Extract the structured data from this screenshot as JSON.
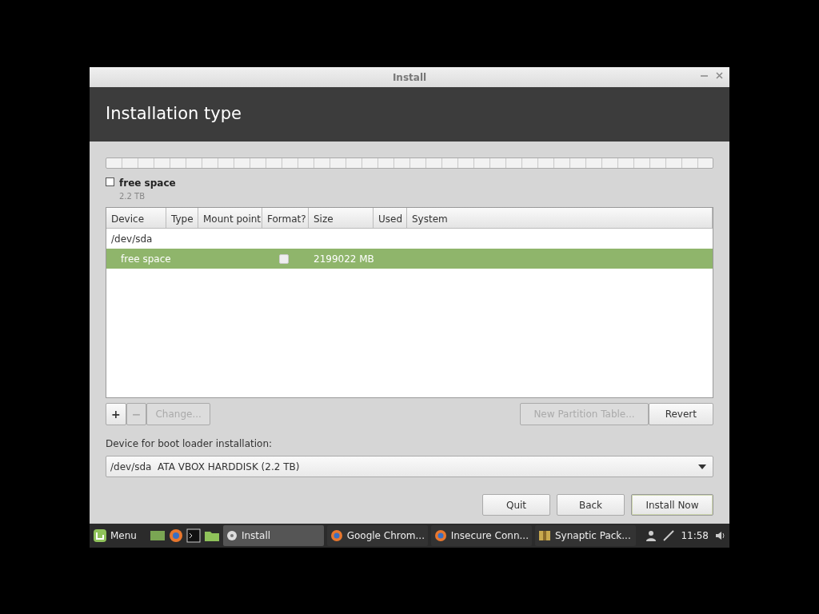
{
  "window": {
    "title": "Install"
  },
  "header": {
    "title": "Installation type"
  },
  "disk_legend": [
    {
      "label": "free space",
      "size": "2.2 TB"
    }
  ],
  "table": {
    "columns": [
      "Device",
      "Type",
      "Mount point",
      "Format?",
      "Size",
      "Used",
      "System"
    ],
    "rows": [
      {
        "device": "/dev/sda",
        "selected": false,
        "children": [
          {
            "device": "free space",
            "format": false,
            "size": "2199022 MB",
            "selected": true
          }
        ]
      }
    ]
  },
  "partition_buttons": [
    {
      "label": "+",
      "disabled": false
    },
    {
      "label": "−",
      "disabled": true
    },
    {
      "label": "Change...",
      "disabled": true
    }
  ],
  "table_buttons": [
    {
      "label": "New Partition Table...",
      "disabled": true
    },
    {
      "label": "Revert",
      "disabled": false
    }
  ],
  "boot_loader": {
    "label": "Device for boot loader installation:",
    "value": "/dev/sda  ATA VBOX HARDDISK (2.2 TB)"
  },
  "dialog_buttons": [
    {
      "label": "Quit",
      "default": false
    },
    {
      "label": "Back",
      "default": false
    },
    {
      "label": "Install Now",
      "default": true
    }
  ],
  "taskbar": {
    "menu": "Menu",
    "tasks": [
      {
        "label": "Install",
        "kind": "disc",
        "selected": true
      },
      {
        "label": "Google Chrom...",
        "kind": "browser",
        "selected": false
      },
      {
        "label": "Insecure Conn...",
        "kind": "browser",
        "selected": false
      },
      {
        "label": "Synaptic Pack...",
        "kind": "package",
        "selected": false
      }
    ],
    "clock": "11:58"
  }
}
